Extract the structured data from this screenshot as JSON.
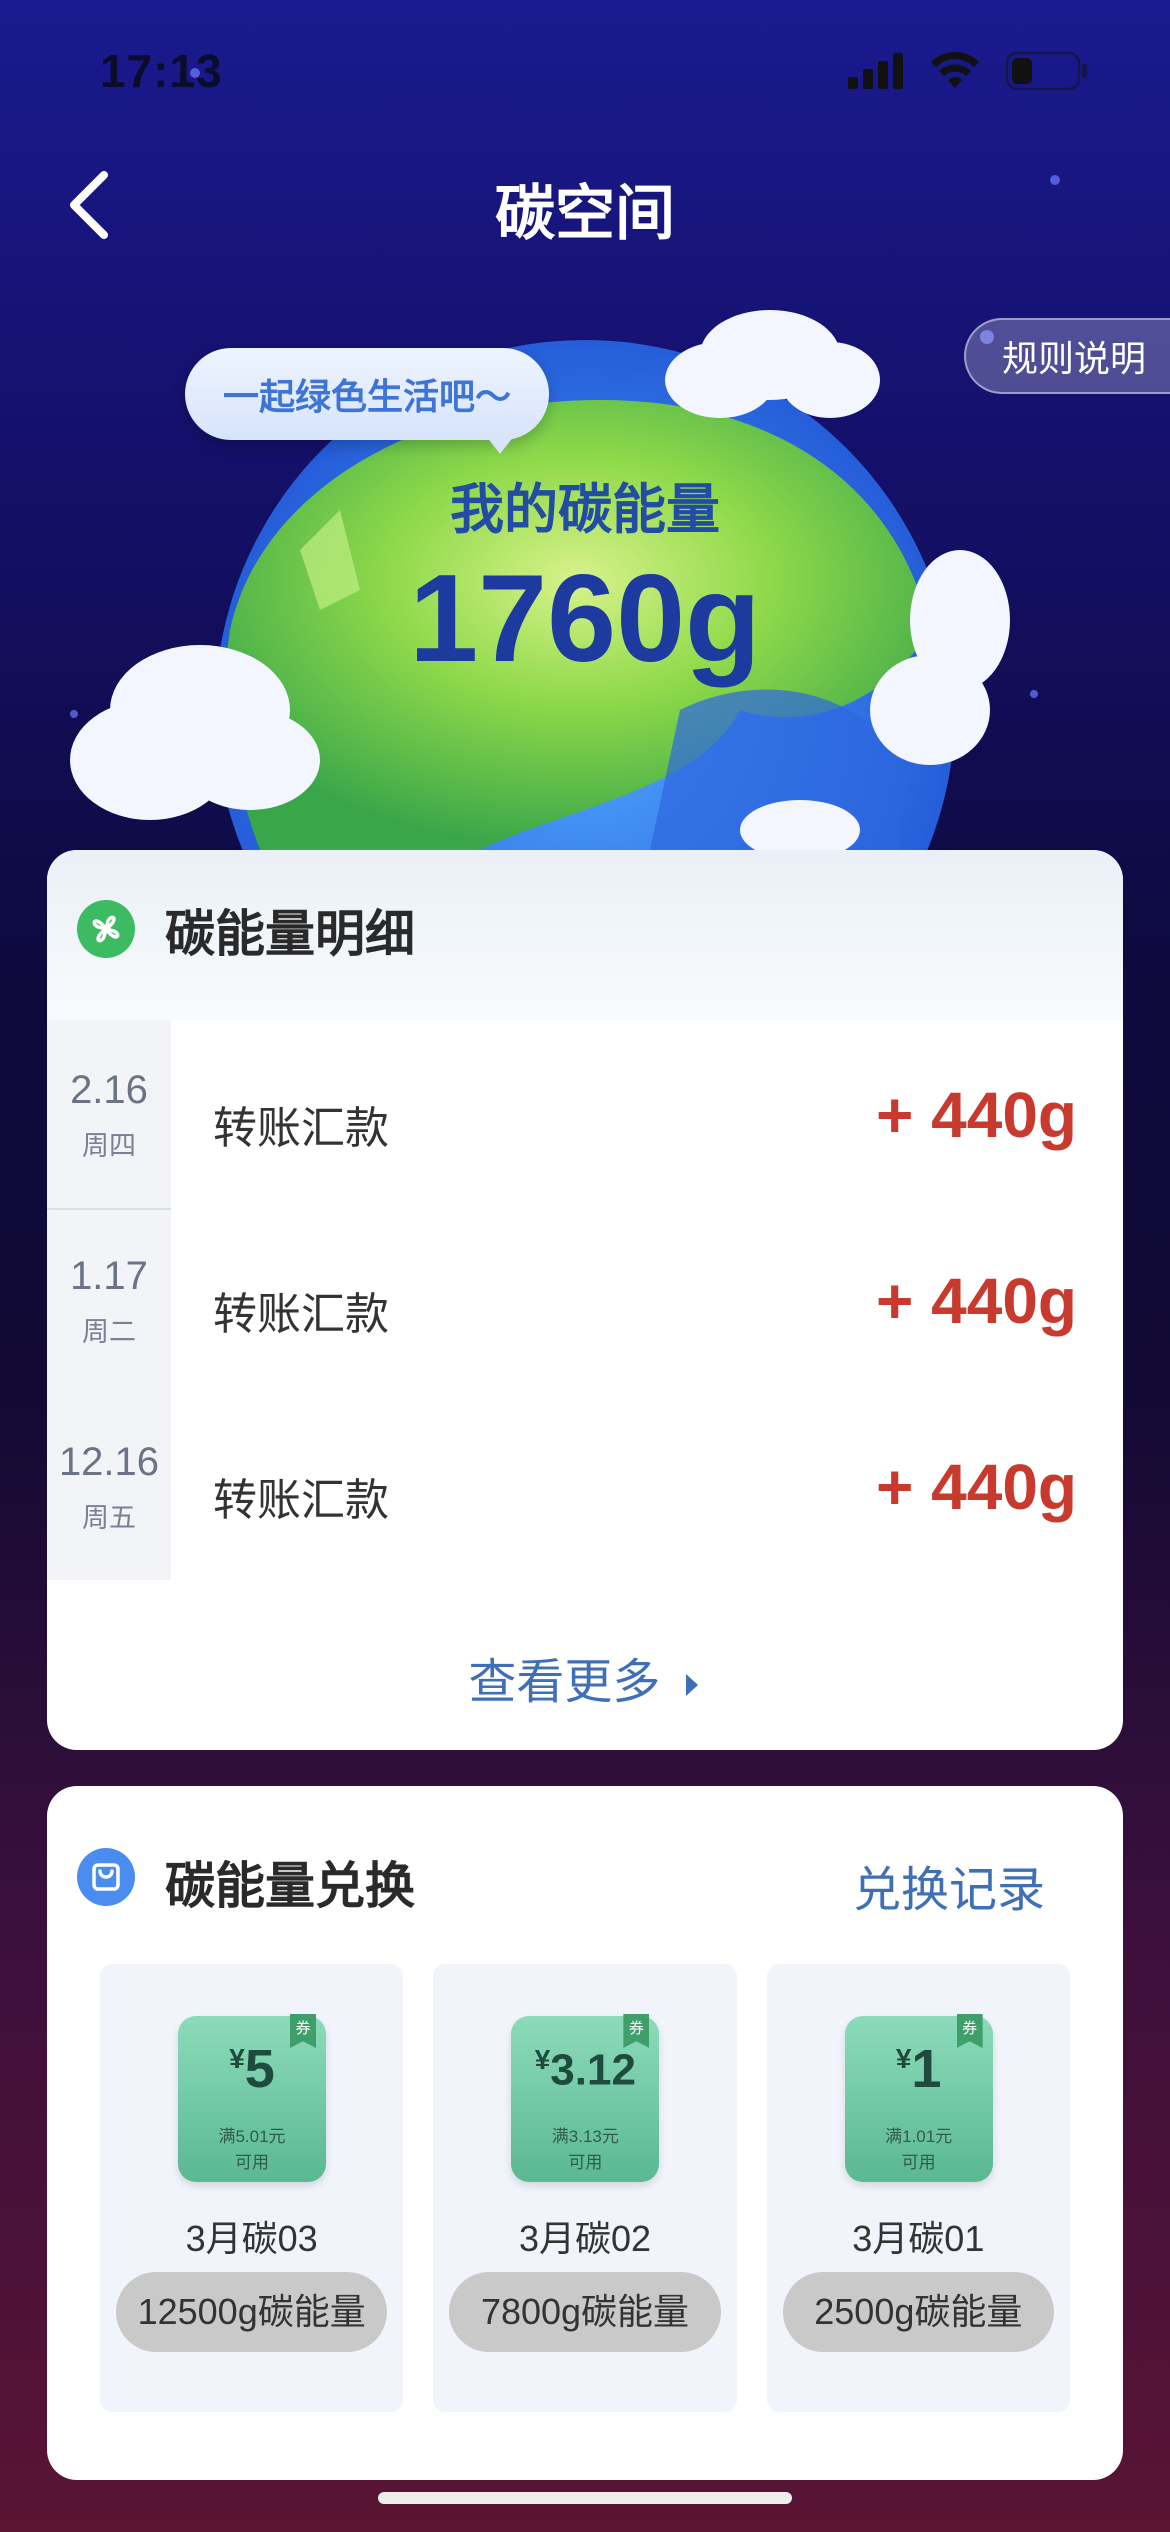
{
  "status": {
    "time": "17:13"
  },
  "nav": {
    "title": "碳空间"
  },
  "rules_button": "规则说明",
  "bubble_text": "一起绿色生活吧～",
  "energy": {
    "label": "我的碳能量",
    "value": "1760g"
  },
  "details": {
    "title": "碳能量明细",
    "rows": [
      {
        "date": "2.16",
        "weekday": "周四",
        "desc": "转账汇款",
        "amount": "+ 440g"
      },
      {
        "date": "1.17",
        "weekday": "周二",
        "desc": "转账汇款",
        "amount": "+ 440g"
      },
      {
        "date": "12.16",
        "weekday": "周五",
        "desc": "转账汇款",
        "amount": "+ 440g"
      }
    ],
    "more": "查看更多"
  },
  "exchange": {
    "title": "碳能量兑换",
    "record_link": "兑换记录",
    "coupons": [
      {
        "currency": "¥",
        "value": "5",
        "cond1": "满5.01元",
        "cond2": "可用",
        "flag": "券",
        "name": "3月碳03",
        "cost": "12500g碳能量"
      },
      {
        "currency": "¥",
        "value": "3.12",
        "cond1": "满3.13元",
        "cond2": "可用",
        "flag": "券",
        "name": "3月碳02",
        "cost": "7800g碳能量"
      },
      {
        "currency": "¥",
        "value": "1",
        "cond1": "满1.01元",
        "cond2": "可用",
        "flag": "券",
        "name": "3月碳01",
        "cost": "2500g碳能量"
      }
    ]
  },
  "colors": {
    "amount": "#c8392e",
    "link": "#3e6fb7",
    "energy": "#1d3a9e"
  }
}
